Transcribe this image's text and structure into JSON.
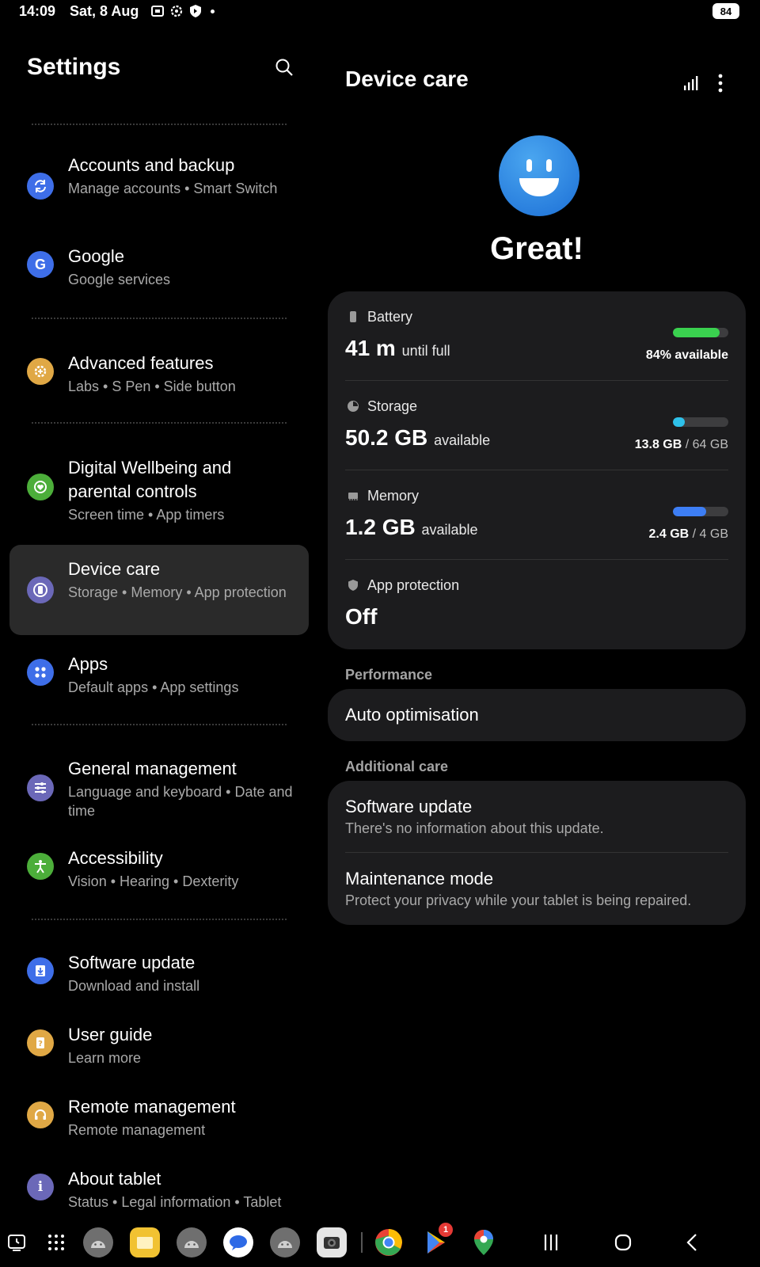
{
  "status_bar": {
    "time": "14:09",
    "date": "Sat, 8 Aug",
    "battery": "84",
    "icons": [
      "screenshot-icon",
      "settings-gear-icon",
      "shield-icon",
      "dot-icon"
    ]
  },
  "left": {
    "title": "Settings",
    "items": [
      {
        "title": "Accounts and backup",
        "sub": "Manage accounts  •  Smart Switch",
        "color": "#3e6ee8",
        "icon": "sync-icon"
      },
      {
        "title": "Google",
        "sub": "Google services",
        "color": "#3e6ee8",
        "icon": "google-icon"
      },
      {
        "title": "Advanced features",
        "sub": "Labs  •  S Pen  •  Side button",
        "color": "#e0a845",
        "icon": "gear-plus-icon"
      },
      {
        "title": "Digital Wellbeing and parental controls",
        "sub": "Screen time  •  App timers",
        "color": "#4cae3a",
        "icon": "wellbeing-icon"
      },
      {
        "title": "Device care",
        "sub": "Storage  •  Memory  •  App protection",
        "color": "#6b68b8",
        "icon": "device-care-icon"
      },
      {
        "title": "Apps",
        "sub": "Default apps  •  App settings",
        "color": "#3e6ee8",
        "icon": "apps-icon"
      },
      {
        "title": "General management",
        "sub": "Language and keyboard  •  Date and time",
        "color": "#6b68b8",
        "icon": "sliders-icon"
      },
      {
        "title": "Accessibility",
        "sub": "Vision  •  Hearing  •  Dexterity",
        "color": "#4cae3a",
        "icon": "accessibility-icon"
      },
      {
        "title": "Software update",
        "sub": "Download and install",
        "color": "#3e6ee8",
        "icon": "download-icon"
      },
      {
        "title": "User guide",
        "sub": "Learn more",
        "color": "#e0a845",
        "icon": "guide-icon"
      },
      {
        "title": "Remote management",
        "sub": "Remote management",
        "color": "#e0a845",
        "icon": "headset-icon"
      },
      {
        "title": "About tablet",
        "sub": "Status  •  Legal information  •  Tablet",
        "color": "#6b68b8",
        "icon": "info-icon"
      }
    ]
  },
  "right": {
    "title": "Device care",
    "status": "Great!",
    "battery": {
      "label": "Battery",
      "big": "41 m",
      "small": "until full",
      "right": "84% available",
      "percent": 84,
      "color": "#3ad14f"
    },
    "storage": {
      "label": "Storage",
      "big": "50.2 GB",
      "small": "available",
      "used": "13.8 GB",
      "total": "/ 64 GB",
      "percent": 21.6,
      "color": "#2ec1ea"
    },
    "memory": {
      "label": "Memory",
      "big": "1.2 GB",
      "small": "available",
      "used": "2.4 GB",
      "total": "/ 4 GB",
      "percent": 60,
      "color": "#3d7ef5"
    },
    "app_protection": {
      "label": "App protection",
      "value": "Off"
    },
    "performance_header": "Performance",
    "auto_optimisation": "Auto optimisation",
    "additional_header": "Additional care",
    "software_update": {
      "title": "Software update",
      "sub": "There's no information about this update."
    },
    "maintenance_mode": {
      "title": "Maintenance mode",
      "sub": "Protect your privacy while your tablet is being repaired."
    }
  },
  "navbar": {
    "apps": [
      "recents-app-icon",
      "app-drawer-icon",
      "android-app-icon",
      "files-icon",
      "android-app-icon",
      "messages-icon",
      "android-app-icon",
      "camera-icon",
      "chrome-icon",
      "play-store-icon",
      "maps-icon"
    ],
    "play_badge": "1"
  }
}
